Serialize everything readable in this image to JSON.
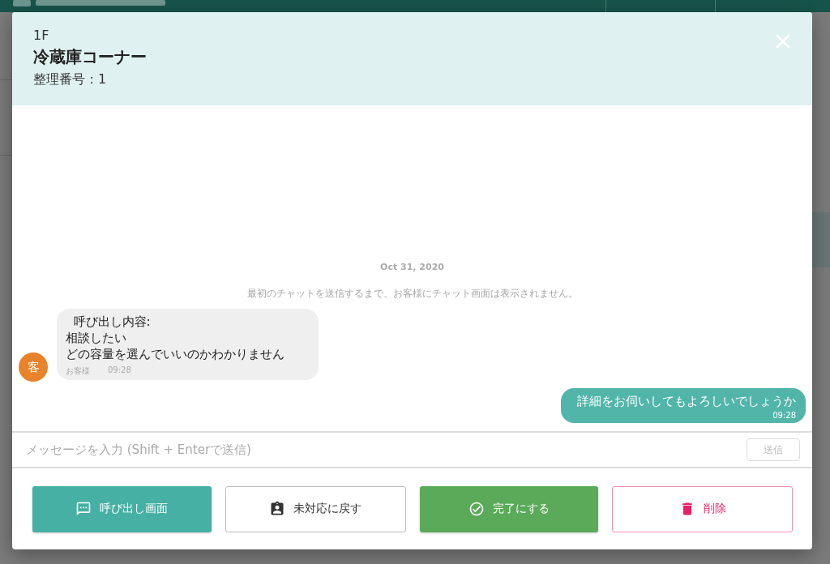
{
  "dialog": {
    "floor": "1F",
    "title": "冷蔵庫コーナー",
    "number": "整理番号：1"
  },
  "chat": {
    "date": "Oct 31, 2020",
    "notice": "最初のチャットを送信するまで、お客様にチャット画面は表示されません。",
    "messages": [
      {
        "kind": "customer",
        "avatar": "客",
        "lines": [
          "  呼び出し内容:",
          "相談したい",
          "どの容量を選んでいいのかわかりません"
        ],
        "name": "お客様",
        "time": "09:28"
      },
      {
        "kind": "staff",
        "lines": [
          "詳細をお伺いしてもよろしいでしょうか"
        ],
        "time": "09:28"
      }
    ]
  },
  "composer": {
    "placeholder": "メッセージを入力 (Shift + Enterで送信)",
    "send_label": "送信",
    "send_disabled": true
  },
  "actions": [
    {
      "kind": "call",
      "label": "呼び出し画面"
    },
    {
      "kind": "revert",
      "label": "未対応に戻す"
    },
    {
      "kind": "complete",
      "label": "完了にする"
    },
    {
      "kind": "delete",
      "label": "削除"
    }
  ]
}
